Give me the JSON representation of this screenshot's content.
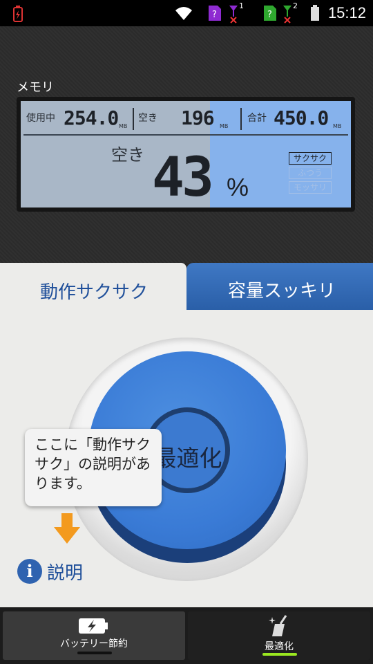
{
  "status_bar": {
    "time": "15:12",
    "sim1": "1",
    "sim2": "2"
  },
  "memory": {
    "title": "メモリ",
    "used_label": "使用中",
    "used_value": "254.0",
    "used_unit": "MB",
    "free_label": "空き",
    "free_value": "196",
    "free_unit": "MB",
    "total_label": "合計",
    "total_value": "450.0",
    "total_unit": "MB",
    "free_percent_label": "空き",
    "free_percent": "43",
    "percent_sign": "%",
    "levels": [
      "サクサク",
      "ふつう",
      "モッサリ"
    ]
  },
  "tabs": [
    {
      "label": "動作サクサク",
      "active": true
    },
    {
      "label": "容量スッキリ",
      "active": false
    }
  ],
  "main": {
    "optimize_label": "最適化",
    "tooltip": "ここに「動作サクサク」の説明があります。",
    "info_label": "説明"
  },
  "nav": [
    {
      "label": "バッテリー節約",
      "icon": "battery-icon"
    },
    {
      "label": "最適化",
      "icon": "broom-icon"
    }
  ],
  "colors": {
    "accent": "#3a7bd6",
    "arrow": "#f39a1e",
    "nav_indicator": "#9be820"
  }
}
